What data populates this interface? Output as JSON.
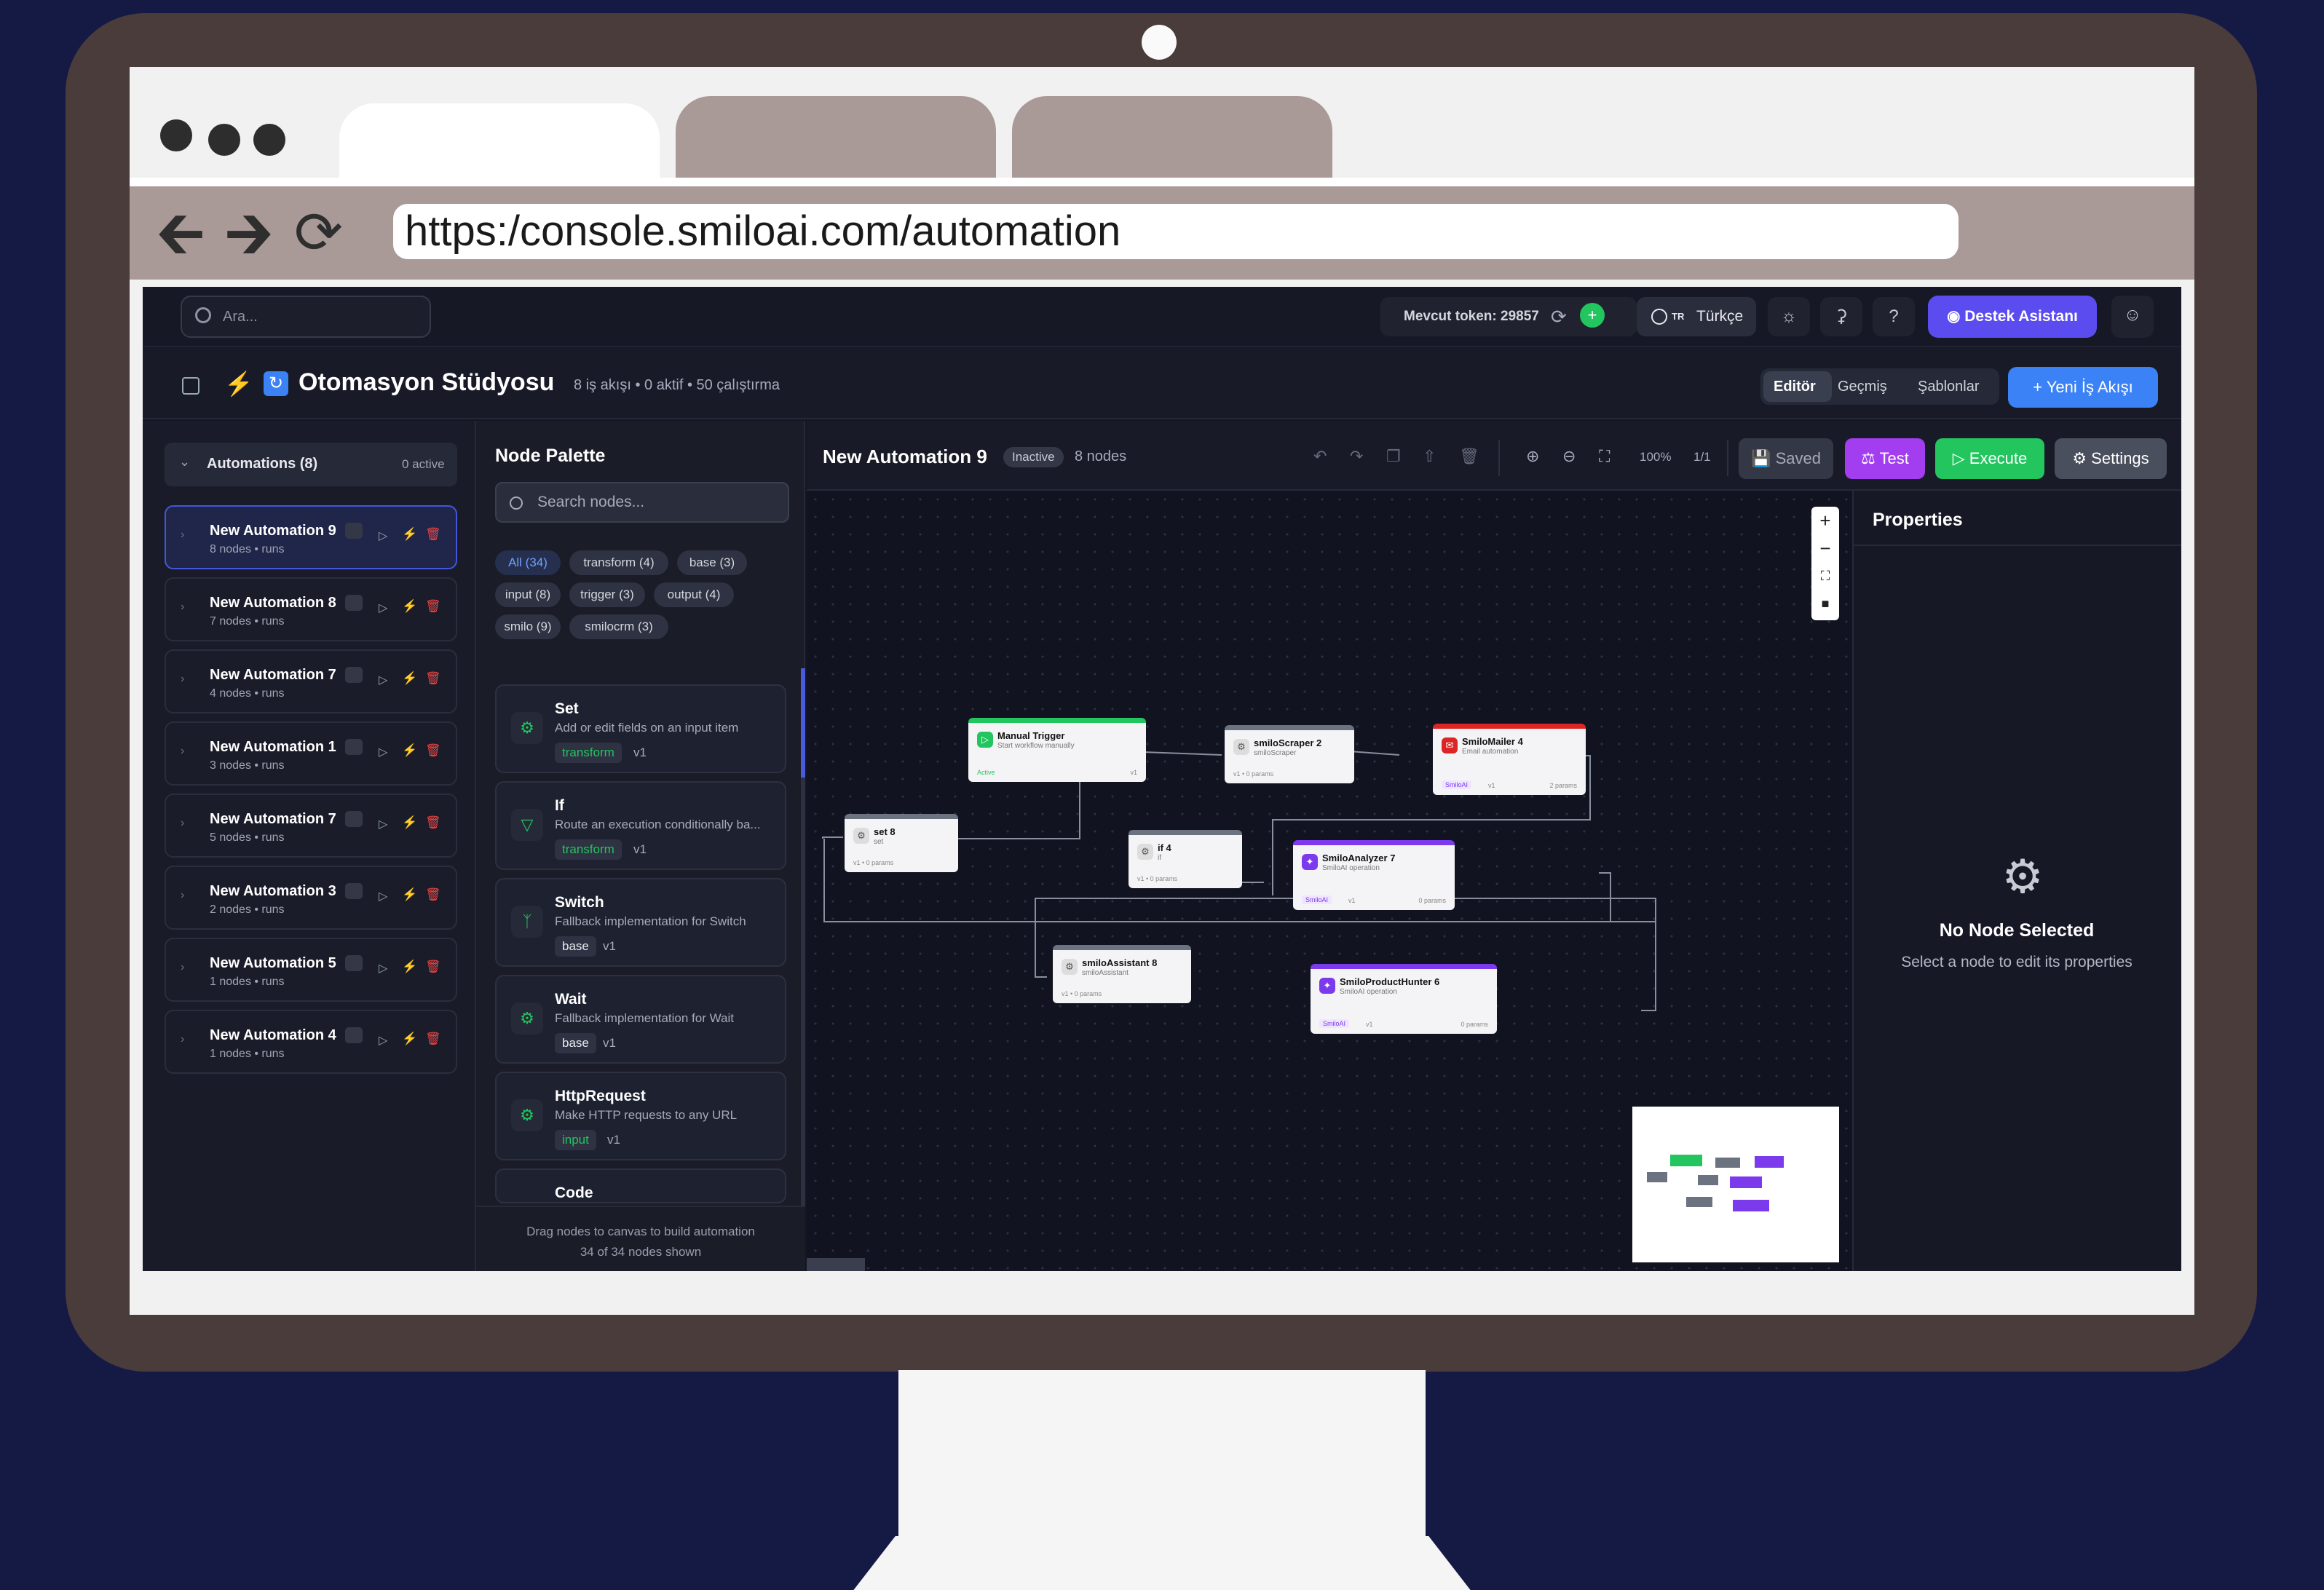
{
  "browser": {
    "url": "https:/console.smiloai.com/automation"
  },
  "topbar": {
    "search_placeholder": "Ara...",
    "token_text": "Mevcut token: 29857",
    "language_flag": "TR",
    "language": "Türkçe",
    "support_button": "Destek Asistanı"
  },
  "studio": {
    "title": "Otomasyon Stüdyosu",
    "stats": "8 iş akışı  •  0 aktif  •  50 çalıştırma",
    "tabs": [
      "Editör",
      "Geçmiş",
      "Şablonlar"
    ],
    "new_flow_button": "+ Yeni İş Akışı"
  },
  "sidebar": {
    "header": "Automations (8)",
    "active_count": "0 active",
    "items": [
      {
        "name": "New Automation 9",
        "meta": "8 nodes • runs"
      },
      {
        "name": "New Automation 8",
        "meta": "7 nodes • runs"
      },
      {
        "name": "New Automation 7",
        "meta": "4 nodes • runs"
      },
      {
        "name": "New Automation 1",
        "meta": "3 nodes • runs"
      },
      {
        "name": "New Automation 7",
        "meta": "5 nodes • runs"
      },
      {
        "name": "New Automation 3",
        "meta": "2 nodes • runs"
      },
      {
        "name": "New Automation 5",
        "meta": "1 nodes • runs"
      },
      {
        "name": "New Automation 4",
        "meta": "1 nodes • runs"
      }
    ]
  },
  "palette": {
    "title": "Node Palette",
    "search_placeholder": "Search nodes...",
    "chips": [
      "All (34)",
      "transform (4)",
      "base (3)",
      "input (8)",
      "trigger (3)",
      "output (4)",
      "smilo (9)",
      "smilocrm (3)"
    ],
    "cards": [
      {
        "name": "Set",
        "desc": "Add or edit fields on an input item",
        "tag": "transform",
        "ver": "v1"
      },
      {
        "name": "If",
        "desc": "Route an execution conditionally ba...",
        "tag": "transform",
        "ver": "v1"
      },
      {
        "name": "Switch",
        "desc": "Fallback implementation for Switch",
        "tag": "base",
        "ver": "v1"
      },
      {
        "name": "Wait",
        "desc": "Fallback implementation for Wait",
        "tag": "base",
        "ver": "v1"
      },
      {
        "name": "HttpRequest",
        "desc": "Make HTTP requests to any URL",
        "tag": "input",
        "ver": "v1"
      },
      {
        "name": "Code",
        "desc": "",
        "tag": "",
        "ver": ""
      }
    ],
    "footer_hint": "Drag nodes to canvas to build automation",
    "footer_count": "34 of 34 nodes shown"
  },
  "editor": {
    "workflow_name": "New Automation 9",
    "status": "Inactive",
    "node_count": "8 nodes",
    "zoom": "100%",
    "page": "1/1",
    "saved": "Saved",
    "test": "Test",
    "execute": "Execute",
    "settings": "Settings"
  },
  "nodes": {
    "manual_trigger": {
      "name": "Manual Trigger",
      "sub": "Start workflow manually",
      "foot": "Active",
      "ver": "v1"
    },
    "scraper": {
      "name": "smiloScraper 2",
      "sub": "smiloScraper",
      "foot": "v1 • 0 params"
    },
    "mailer": {
      "name": "SmiloMailer 4",
      "sub": "Email automation",
      "badge": "SmiloAI",
      "ver": "v1",
      "params": "2 params"
    },
    "set8": {
      "name": "set 8",
      "sub": "set",
      "foot": "v1 • 0 params"
    },
    "if4": {
      "name": "if 4",
      "sub": "if",
      "foot": "v1 • 0 params"
    },
    "analyzer": {
      "name": "SmiloAnalyzer 7",
      "sub": "SmiloAI operation",
      "badge": "SmiloAI",
      "ver": "v1",
      "params": "0 params"
    },
    "assistant": {
      "name": "smiloAssistant 8",
      "sub": "smiloAssistant",
      "foot": "v1 • 0 params"
    },
    "hunter": {
      "name": "SmiloProductHunter 6",
      "sub": "SmiloAI operation",
      "badge": "SmiloAI",
      "ver": "v1",
      "params": "0 params"
    }
  },
  "properties": {
    "title": "Properties",
    "empty_title": "No Node Selected",
    "empty_desc": "Select a node to edit its properties"
  }
}
